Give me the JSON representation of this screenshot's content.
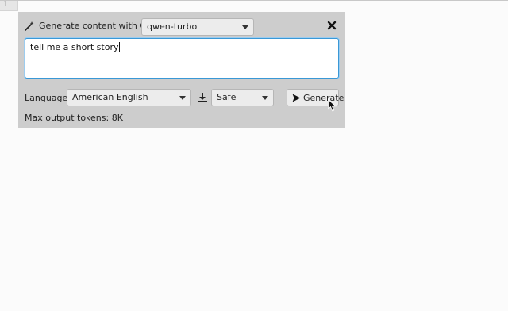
{
  "gutter": {
    "line_number": "1"
  },
  "panel": {
    "title": "Generate content with Qwen",
    "model": {
      "selected": "qwen-turbo"
    },
    "prompt": {
      "value": "tell me a short story"
    },
    "language": {
      "label": "Language:",
      "selected": "American English"
    },
    "safety": {
      "selected": "Safe"
    },
    "generate_label": "Generate",
    "tokens_text": "Max output tokens: 8K"
  },
  "icons": {
    "wand": "magic-wand-icon",
    "close": "close-icon",
    "safety": "safety-filter-icon",
    "send": "send-icon",
    "pointer": "mouse-pointer-icon"
  },
  "colors": {
    "panel_bg": "#cdcdcd",
    "focus_border": "#3a98d6",
    "page_bg": "#fbfbfb"
  }
}
